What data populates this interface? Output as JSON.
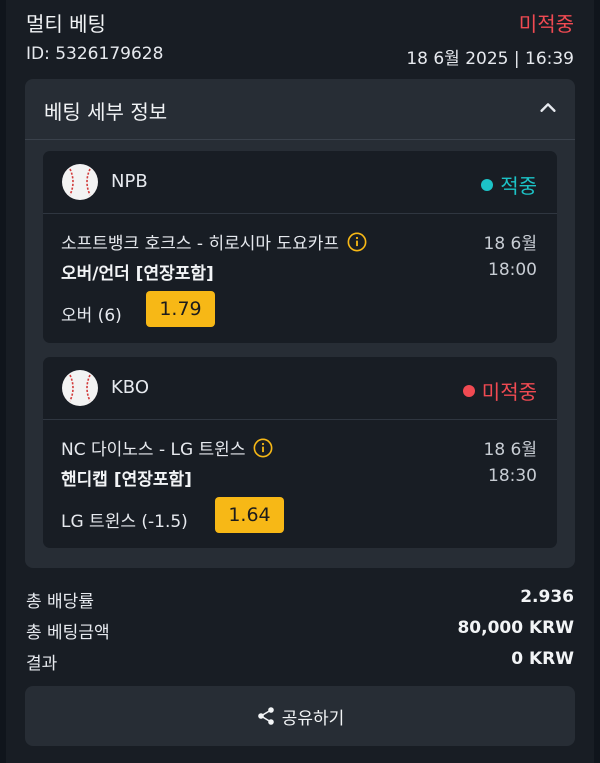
{
  "header": {
    "title": "멀티 베팅",
    "status": "미적중",
    "id_text": "ID: 5326179628",
    "datetime": "18 6월 2025 | 16:39"
  },
  "details": {
    "title": "베팅 세부 정보",
    "bets": [
      {
        "league": "NPB",
        "status": "적중",
        "status_color": "#1cc3c7",
        "match": "소프트뱅크 호크스 - 히로시마 도요카프",
        "date": "18 6월",
        "market": "오버/언더 [연장포함]",
        "time": "18:00",
        "pick": "오버 (6)",
        "odds": "1.79"
      },
      {
        "league": "KBO",
        "status": "미적중",
        "status_color": "#f04a52",
        "match": "NC 다이노스 - LG 트윈스",
        "date": "18 6월",
        "market": "핸디캡 [연장포함]",
        "time": "18:30",
        "pick": "LG 트윈스 (-1.5)",
        "odds": "1.64"
      }
    ]
  },
  "summary": {
    "total_odds_label": "총 배당률",
    "total_odds": "2.936",
    "stake_label": "총 베팅금액",
    "stake": "80,000 KRW",
    "result_label": "결과",
    "result": "0 KRW"
  },
  "share": {
    "label": "공유하기"
  },
  "colors": {
    "accent_odds": "#f7b816",
    "lost": "#f04a52",
    "won": "#1cc3c7"
  },
  "icons": [
    "baseball-icon",
    "info-icon",
    "chevron-up-icon",
    "share-icon"
  ]
}
